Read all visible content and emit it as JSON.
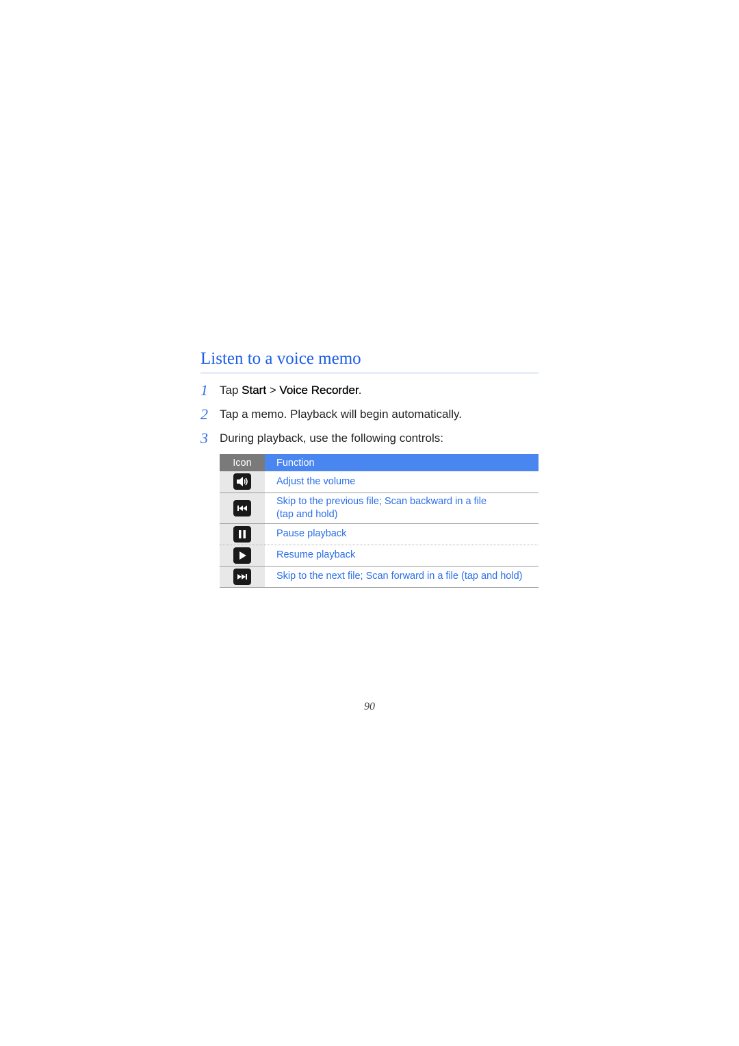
{
  "section": {
    "title": "Listen to a voice memo"
  },
  "steps": [
    {
      "number": "1",
      "prefix": "Tap ",
      "bold1": "Start",
      "sep": " > ",
      "bold2": "Voice Recorder",
      "suffix": "."
    },
    {
      "number": "2",
      "text": "Tap a memo. Playback will begin automatically."
    },
    {
      "number": "3",
      "text": "During playback, use the following controls:"
    }
  ],
  "table": {
    "headers": {
      "icon": "Icon",
      "function": "Function"
    },
    "rows": [
      {
        "icon": "volume-icon",
        "function_line1": "Adjust the volume",
        "function_line2": ""
      },
      {
        "icon": "skip-previous-icon",
        "function_line1": "Skip to the previous file; Scan backward in a file",
        "function_line2": "(tap and hold)"
      },
      {
        "icon": "pause-icon",
        "function_line1": "Pause playback",
        "function_line2": ""
      },
      {
        "icon": "play-icon",
        "function_line1": "Resume playback",
        "function_line2": ""
      },
      {
        "icon": "skip-next-icon",
        "function_line1": "Skip to the next file; Scan forward in a file (tap and hold)",
        "function_line2": ""
      }
    ]
  },
  "page_number": "90"
}
